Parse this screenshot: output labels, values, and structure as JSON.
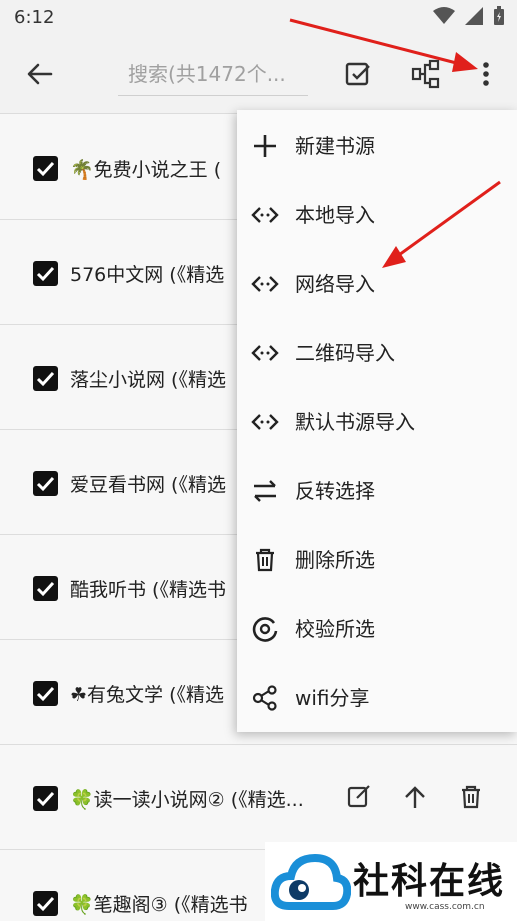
{
  "status_bar": {
    "time": "6:12"
  },
  "toolbar": {
    "search_placeholder": "搜索(共1472个..."
  },
  "sources": [
    {
      "label": "🌴免费小说之王 (",
      "checked": true
    },
    {
      "label": "576中文网 (《精选",
      "checked": true
    },
    {
      "label": "落尘小说网 (《精选",
      "checked": true
    },
    {
      "label": "爱豆看书网 (《精选",
      "checked": true
    },
    {
      "label": "酷我听书 (《精选书",
      "checked": true
    },
    {
      "label": "☘有兔文学 (《精选",
      "checked": true
    },
    {
      "label": "🍀读一读小说网② (《精选...",
      "checked": true
    },
    {
      "label": "🍀笔趣阁③ (《精选书",
      "checked": true
    }
  ],
  "menu": {
    "items": [
      {
        "label": "新建书源",
        "icon": "plus-icon"
      },
      {
        "label": "本地导入",
        "icon": "code-icon"
      },
      {
        "label": "网络导入",
        "icon": "code-icon"
      },
      {
        "label": "二维码导入",
        "icon": "code-icon"
      },
      {
        "label": "默认书源导入",
        "icon": "code-icon"
      },
      {
        "label": "反转选择",
        "icon": "swap-icon"
      },
      {
        "label": "删除所选",
        "icon": "trash-icon"
      },
      {
        "label": "校验所选",
        "icon": "check-circle-icon"
      },
      {
        "label": "wifi分享",
        "icon": "share-icon"
      }
    ]
  },
  "watermark": {
    "title": "社科在线",
    "url": "www.cass.com.cn"
  },
  "colors": {
    "arrow": "#e0201b",
    "checkbox": "#111111",
    "menu_bg": "#fafafa"
  }
}
